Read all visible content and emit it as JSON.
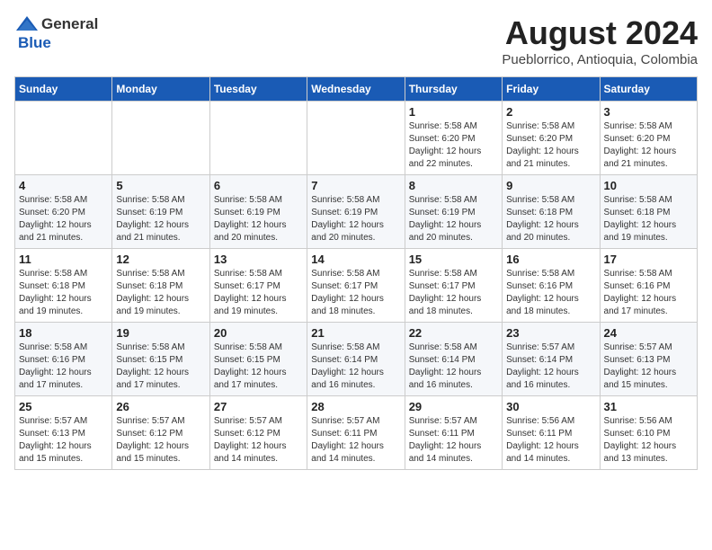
{
  "header": {
    "logo_general": "General",
    "logo_blue": "Blue",
    "title": "August 2024",
    "subtitle": "Pueblorrico, Antioquia, Colombia"
  },
  "days_of_week": [
    "Sunday",
    "Monday",
    "Tuesday",
    "Wednesday",
    "Thursday",
    "Friday",
    "Saturday"
  ],
  "weeks": [
    [
      {
        "day": "",
        "info": ""
      },
      {
        "day": "",
        "info": ""
      },
      {
        "day": "",
        "info": ""
      },
      {
        "day": "",
        "info": ""
      },
      {
        "day": "1",
        "info": "Sunrise: 5:58 AM\nSunset: 6:20 PM\nDaylight: 12 hours\nand 22 minutes."
      },
      {
        "day": "2",
        "info": "Sunrise: 5:58 AM\nSunset: 6:20 PM\nDaylight: 12 hours\nand 21 minutes."
      },
      {
        "day": "3",
        "info": "Sunrise: 5:58 AM\nSunset: 6:20 PM\nDaylight: 12 hours\nand 21 minutes."
      }
    ],
    [
      {
        "day": "4",
        "info": "Sunrise: 5:58 AM\nSunset: 6:20 PM\nDaylight: 12 hours\nand 21 minutes."
      },
      {
        "day": "5",
        "info": "Sunrise: 5:58 AM\nSunset: 6:19 PM\nDaylight: 12 hours\nand 21 minutes."
      },
      {
        "day": "6",
        "info": "Sunrise: 5:58 AM\nSunset: 6:19 PM\nDaylight: 12 hours\nand 20 minutes."
      },
      {
        "day": "7",
        "info": "Sunrise: 5:58 AM\nSunset: 6:19 PM\nDaylight: 12 hours\nand 20 minutes."
      },
      {
        "day": "8",
        "info": "Sunrise: 5:58 AM\nSunset: 6:19 PM\nDaylight: 12 hours\nand 20 minutes."
      },
      {
        "day": "9",
        "info": "Sunrise: 5:58 AM\nSunset: 6:18 PM\nDaylight: 12 hours\nand 20 minutes."
      },
      {
        "day": "10",
        "info": "Sunrise: 5:58 AM\nSunset: 6:18 PM\nDaylight: 12 hours\nand 19 minutes."
      }
    ],
    [
      {
        "day": "11",
        "info": "Sunrise: 5:58 AM\nSunset: 6:18 PM\nDaylight: 12 hours\nand 19 minutes."
      },
      {
        "day": "12",
        "info": "Sunrise: 5:58 AM\nSunset: 6:18 PM\nDaylight: 12 hours\nand 19 minutes."
      },
      {
        "day": "13",
        "info": "Sunrise: 5:58 AM\nSunset: 6:17 PM\nDaylight: 12 hours\nand 19 minutes."
      },
      {
        "day": "14",
        "info": "Sunrise: 5:58 AM\nSunset: 6:17 PM\nDaylight: 12 hours\nand 18 minutes."
      },
      {
        "day": "15",
        "info": "Sunrise: 5:58 AM\nSunset: 6:17 PM\nDaylight: 12 hours\nand 18 minutes."
      },
      {
        "day": "16",
        "info": "Sunrise: 5:58 AM\nSunset: 6:16 PM\nDaylight: 12 hours\nand 18 minutes."
      },
      {
        "day": "17",
        "info": "Sunrise: 5:58 AM\nSunset: 6:16 PM\nDaylight: 12 hours\nand 17 minutes."
      }
    ],
    [
      {
        "day": "18",
        "info": "Sunrise: 5:58 AM\nSunset: 6:16 PM\nDaylight: 12 hours\nand 17 minutes."
      },
      {
        "day": "19",
        "info": "Sunrise: 5:58 AM\nSunset: 6:15 PM\nDaylight: 12 hours\nand 17 minutes."
      },
      {
        "day": "20",
        "info": "Sunrise: 5:58 AM\nSunset: 6:15 PM\nDaylight: 12 hours\nand 17 minutes."
      },
      {
        "day": "21",
        "info": "Sunrise: 5:58 AM\nSunset: 6:14 PM\nDaylight: 12 hours\nand 16 minutes."
      },
      {
        "day": "22",
        "info": "Sunrise: 5:58 AM\nSunset: 6:14 PM\nDaylight: 12 hours\nand 16 minutes."
      },
      {
        "day": "23",
        "info": "Sunrise: 5:57 AM\nSunset: 6:14 PM\nDaylight: 12 hours\nand 16 minutes."
      },
      {
        "day": "24",
        "info": "Sunrise: 5:57 AM\nSunset: 6:13 PM\nDaylight: 12 hours\nand 15 minutes."
      }
    ],
    [
      {
        "day": "25",
        "info": "Sunrise: 5:57 AM\nSunset: 6:13 PM\nDaylight: 12 hours\nand 15 minutes."
      },
      {
        "day": "26",
        "info": "Sunrise: 5:57 AM\nSunset: 6:12 PM\nDaylight: 12 hours\nand 15 minutes."
      },
      {
        "day": "27",
        "info": "Sunrise: 5:57 AM\nSunset: 6:12 PM\nDaylight: 12 hours\nand 14 minutes."
      },
      {
        "day": "28",
        "info": "Sunrise: 5:57 AM\nSunset: 6:11 PM\nDaylight: 12 hours\nand 14 minutes."
      },
      {
        "day": "29",
        "info": "Sunrise: 5:57 AM\nSunset: 6:11 PM\nDaylight: 12 hours\nand 14 minutes."
      },
      {
        "day": "30",
        "info": "Sunrise: 5:56 AM\nSunset: 6:11 PM\nDaylight: 12 hours\nand 14 minutes."
      },
      {
        "day": "31",
        "info": "Sunrise: 5:56 AM\nSunset: 6:10 PM\nDaylight: 12 hours\nand 13 minutes."
      }
    ]
  ]
}
